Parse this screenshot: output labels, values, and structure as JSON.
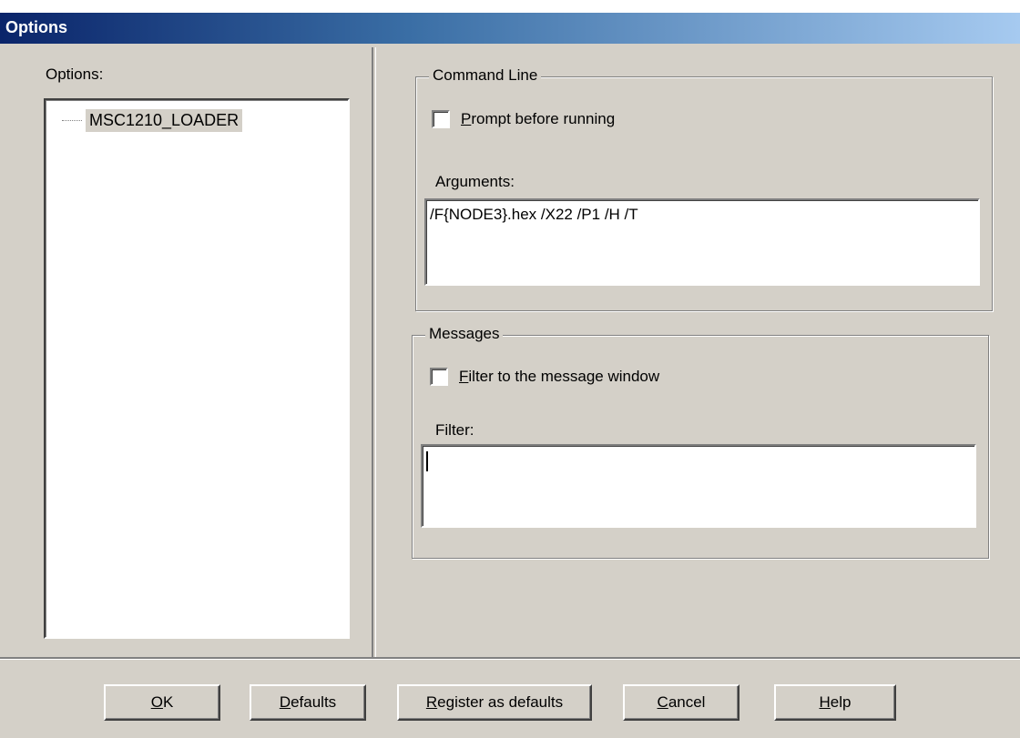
{
  "window": {
    "title": "Options"
  },
  "left": {
    "label": "Options:",
    "tree_items": [
      {
        "label": "MSC1210_LOADER"
      }
    ]
  },
  "command_line": {
    "legend": "Command Line",
    "prompt_checkbox": {
      "label_prefix": "",
      "accel": "P",
      "label_rest": "rompt before running",
      "checked": false
    },
    "arguments_label": "Arguments:",
    "arguments_value": "/F{NODE3}.hex /X22 /P1 /H /T"
  },
  "messages": {
    "legend": "Messages",
    "filter_checkbox": {
      "accel": "F",
      "label_rest": "ilter to the message window",
      "checked": false
    },
    "filter_label": "Filter:",
    "filter_value": ""
  },
  "buttons": {
    "ok": {
      "accel": "O",
      "rest": "K"
    },
    "defaults": {
      "accel": "D",
      "rest": "efaults"
    },
    "register": {
      "accel": "R",
      "rest": "egister as defaults"
    },
    "cancel": {
      "accel": "C",
      "rest": "ancel"
    },
    "help": {
      "accel": "H",
      "rest": "elp"
    }
  }
}
